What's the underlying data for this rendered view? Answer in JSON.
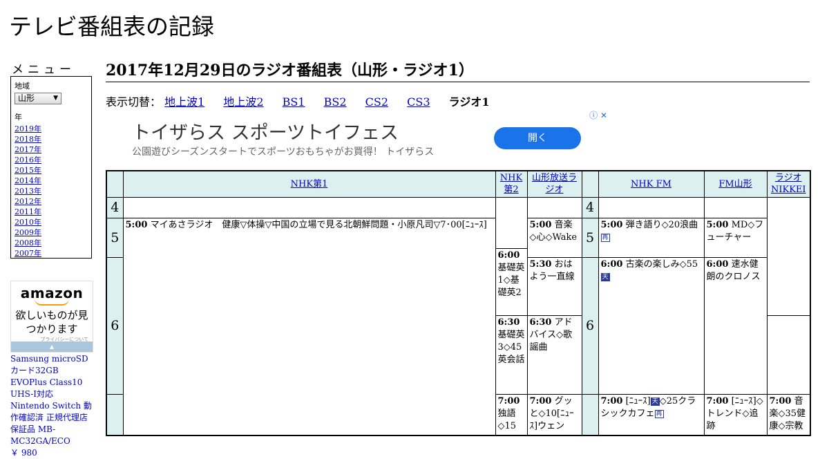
{
  "site": {
    "title": "テレビ番組表の記録"
  },
  "menu": {
    "heading": "メニュー",
    "region_label": "地域",
    "region_value": "山形",
    "year_label": "年",
    "years": [
      "2019年",
      "2018年",
      "2017年",
      "2016年",
      "2015年",
      "2014年",
      "2013年",
      "2012年",
      "2011年",
      "2010年",
      "2009年",
      "2008年",
      "2007年"
    ]
  },
  "side_ad": {
    "logo": "amazon",
    "copy": "欲しいものが見つかります",
    "privacy": "プライバシーについて",
    "product": "Samsung microSDカード32GB EVOPlus Class10 UHS-I対応 Nintendo Switch 動作確認済 正規代理店保証品 MB-MC32GA/ECO",
    "price": "￥ 980"
  },
  "page": {
    "title": "2017年12月29日のラジオ番組表（山形・ラジオ1）"
  },
  "switcher": {
    "prefix": "表示切替：",
    "links": [
      "地上波1",
      "地上波2",
      "BS1",
      "BS2",
      "CS2",
      "CS3"
    ],
    "current": "ラジオ1"
  },
  "banner_ad": {
    "title": "トイザらス スポーツトイフェス",
    "subtitle": "公園遊びシーズンスタートでスポーツおもちゃがお買得！ トイザらス",
    "button": "開く",
    "info_icon": "info-icon",
    "close_icon": "close-icon"
  },
  "schedule": {
    "channels": [
      "NHK第1",
      "NHK第2",
      "山形放送ラジオ",
      "NHK FM",
      "FM山形",
      "ラジオNIKKEI"
    ],
    "hours": [
      "4",
      "5",
      "6"
    ],
    "programs": {
      "nhk1_500_time": "5:00",
      "nhk1_500_title": "マイあさラジオ　健康▽体操▽中国の立場で見る北朝鮮問題・小原凡司▽7･00[ﾆｭｰｽ]",
      "nhk2_600_time": "6:00",
      "nhk2_600_title": "基礎英1◇基礎英2",
      "nhk2_630_time": "6:30",
      "nhk2_630_title": "基礎英3◇45英会話",
      "nhk2_700_time": "7:00",
      "nhk2_700_title": "独語◇15",
      "ybc_500_time": "5:00",
      "ybc_500_title": "音楽◇心◇Wake",
      "ybc_530_time": "5:30",
      "ybc_530_title": "おはよう一直線",
      "ybc_630_time": "6:30",
      "ybc_630_title": "アドバイス◇歌謡曲",
      "ybc_700_time": "7:00",
      "ybc_700_title": "グッと◇10[ﾆｭｰｽ]ウェン",
      "fm_500_time": "5:00",
      "fm_500_title": "弾き語り◇20浪曲",
      "fm_600_time": "6:00",
      "fm_600_title": "古楽の楽しみ◇55",
      "fm_700_time": "7:00",
      "fm_700_title_a": "[ﾆｭｰｽ]",
      "fm_700_title_b": "◇25クラシックカフェ",
      "fmy_500_time": "5:00",
      "fmy_500_title": "MD◇フューチャー",
      "fmy_600_time": "6:00",
      "fmy_600_title": "速水健朗のクロノス",
      "fmy_700_time": "7:00",
      "fmy_700_title": "[ﾆｭｰｽ]◇トレンド◇追跡",
      "nikkei_700_time": "7:00",
      "nikkei_700_title": "音楽◇35健康◇宗教"
    },
    "badges": {
      "rebroadcast": "再",
      "stereo": "天"
    }
  }
}
